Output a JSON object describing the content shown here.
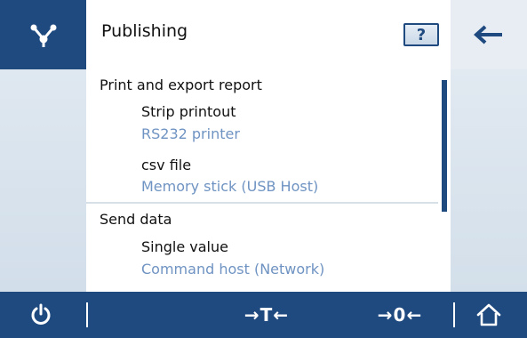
{
  "header": {
    "title": "Publishing",
    "help_label": "?"
  },
  "content": {
    "sections": [
      {
        "label": "Print and export report",
        "items": [
          {
            "title": "Strip printout",
            "subtitle": "RS232 printer"
          },
          {
            "title": "csv file",
            "subtitle": "Memory stick (USB Host)"
          }
        ]
      },
      {
        "label": "Send data",
        "items": [
          {
            "title": "Single value",
            "subtitle": "Command host (Network)"
          }
        ]
      }
    ]
  },
  "bottom_bar": {
    "tare_label": "→T←",
    "zero_label": "→0←"
  },
  "icons": {
    "app": "branch-network-icon",
    "back": "arrow-left-icon",
    "power": "power-icon",
    "home": "home-icon"
  },
  "colors": {
    "primary": "#1f4a80",
    "subtitle": "#6f93c2",
    "panel": "#dde6ef"
  }
}
